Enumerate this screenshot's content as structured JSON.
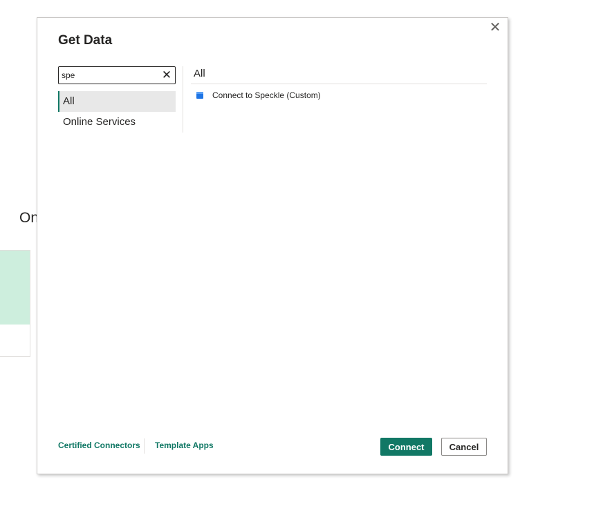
{
  "background": {
    "partial_label": "On",
    "card_accent_color": "#cdeedd"
  },
  "dialog": {
    "title": "Get Data",
    "close_icon": "close-icon",
    "search": {
      "value": "spe",
      "clear_icon": "clear-icon"
    },
    "categories": [
      {
        "label": "All",
        "selected": true
      },
      {
        "label": "Online Services",
        "selected": false
      }
    ],
    "results": {
      "header": "All",
      "items": [
        {
          "label": "Connect to Speckle (Custom)",
          "icon": "speckle-connector-icon",
          "icon_color": "#1f75e5"
        }
      ]
    },
    "footer": {
      "certified_connectors": "Certified Connectors",
      "template_apps": "Template Apps",
      "connect_label": "Connect",
      "cancel_label": "Cancel"
    },
    "accent_color": "#117865"
  }
}
